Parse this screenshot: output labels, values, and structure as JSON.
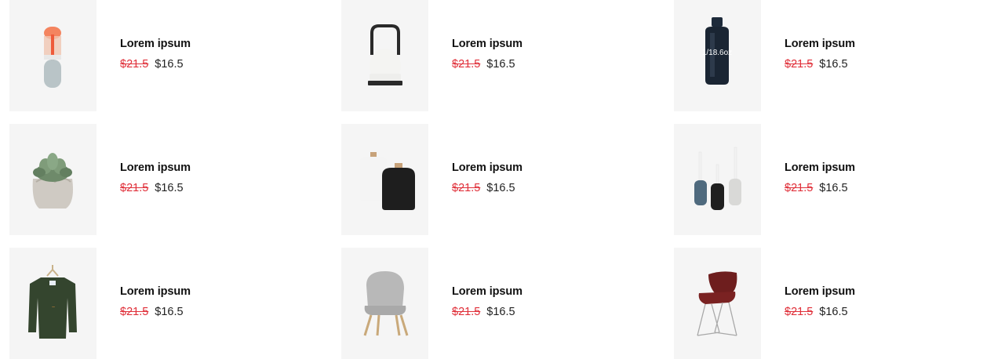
{
  "colors": {
    "thumb_background": "#f5f5f5",
    "old_price": "#e0303a",
    "new_price": "#222222",
    "title": "#111111"
  },
  "products": [
    {
      "title": "Lorem ipsum",
      "old_price": "$21.5",
      "new_price": "$16.5",
      "image": "water-bottle-capsule"
    },
    {
      "title": "Lorem ipsum",
      "old_price": "$21.5",
      "new_price": "$16.5",
      "image": "lantern"
    },
    {
      "title": "Lorem ipsum",
      "old_price": "$21.5",
      "new_price": "$16.5",
      "image": "dark-bottle",
      "image_text": "1/18.6oz"
    },
    {
      "title": "Lorem ipsum",
      "old_price": "$21.5",
      "new_price": "$16.5",
      "image": "succulent-paper-bag"
    },
    {
      "title": "Lorem ipsum",
      "old_price": "$21.5",
      "new_price": "$16.5",
      "image": "ceramic-vases"
    },
    {
      "title": "Lorem ipsum",
      "old_price": "$21.5",
      "new_price": "$16.5",
      "image": "candle-holders"
    },
    {
      "title": "Lorem ipsum",
      "old_price": "$21.5",
      "new_price": "$16.5",
      "image": "green-sweater-hanger"
    },
    {
      "title": "Lorem ipsum",
      "old_price": "$21.5",
      "new_price": "$16.5",
      "image": "grey-chair"
    },
    {
      "title": "Lorem ipsum",
      "old_price": "$21.5",
      "new_price": "$16.5",
      "image": "red-eiffel-chair"
    }
  ]
}
